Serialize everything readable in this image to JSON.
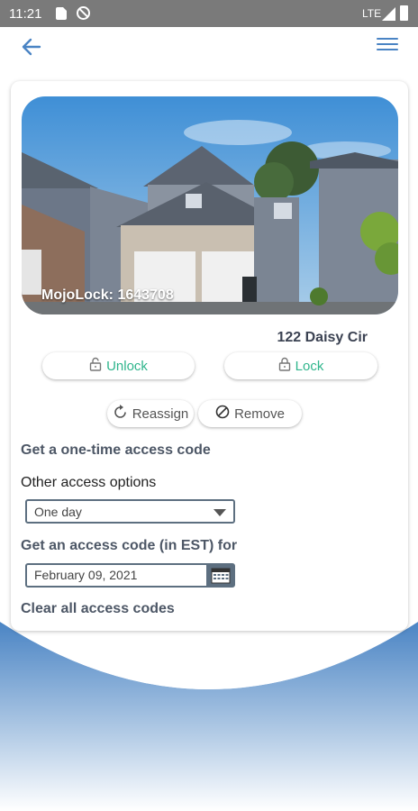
{
  "status_bar": {
    "time": "11:21",
    "network": "LTE"
  },
  "header": {
    "back_icon": "arrow-left-icon",
    "menu_icon": "hamburger-menu-icon"
  },
  "colors": {
    "accent": "#4a84c4",
    "lock_green": "#2fb58c",
    "text_gray": "#4d5766",
    "wave_blue": "#4a84c4"
  },
  "property": {
    "lock_label": "MojoLock: 1643708",
    "address": "122 Daisy Cir"
  },
  "actions": {
    "unlock_label": "Unlock",
    "lock_label": "Lock",
    "reassign_label": "Reassign",
    "remove_label": "Remove"
  },
  "access": {
    "one_time_label": "Get a one-time access code",
    "other_options_label": "Other access options",
    "duration_selected": "One day",
    "access_code_est_label": "Get an access code (in EST) for",
    "date_value": "February 09, 2021",
    "clear_label": "Clear all access codes"
  }
}
